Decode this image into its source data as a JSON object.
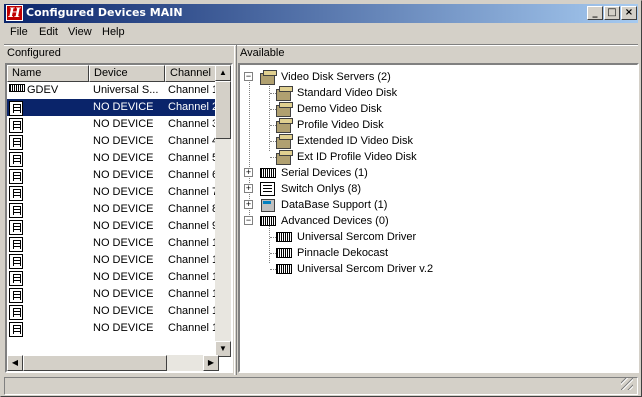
{
  "window": {
    "title": "Configured Devices MAIN",
    "app_icon_letter": "H"
  },
  "menu": {
    "file": "File",
    "edit": "Edit",
    "view": "View",
    "help": "Help"
  },
  "configured": {
    "header": "Configured",
    "columns": [
      "Name",
      "Device",
      "Channel"
    ],
    "rows": [
      {
        "name": "GDEV",
        "device": "Universal S...",
        "channel": "Channel 1"
      },
      {
        "name": "",
        "device": "NO DEVICE",
        "channel": "Channel 2"
      },
      {
        "name": "",
        "device": "NO DEVICE",
        "channel": "Channel 3"
      },
      {
        "name": "",
        "device": "NO DEVICE",
        "channel": "Channel 4"
      },
      {
        "name": "",
        "device": "NO DEVICE",
        "channel": "Channel 5"
      },
      {
        "name": "",
        "device": "NO DEVICE",
        "channel": "Channel 6"
      },
      {
        "name": "",
        "device": "NO DEVICE",
        "channel": "Channel 7"
      },
      {
        "name": "",
        "device": "NO DEVICE",
        "channel": "Channel 8"
      },
      {
        "name": "",
        "device": "NO DEVICE",
        "channel": "Channel 9"
      },
      {
        "name": "",
        "device": "NO DEVICE",
        "channel": "Channel 1"
      },
      {
        "name": "",
        "device": "NO DEVICE",
        "channel": "Channel 1"
      },
      {
        "name": "",
        "device": "NO DEVICE",
        "channel": "Channel 1"
      },
      {
        "name": "",
        "device": "NO DEVICE",
        "channel": "Channel 1"
      },
      {
        "name": "",
        "device": "NO DEVICE",
        "channel": "Channel 1"
      },
      {
        "name": "",
        "device": "NO DEVICE",
        "channel": "Channel 1"
      }
    ],
    "selected_row": 1
  },
  "available": {
    "header": "Available",
    "video_disk_servers": {
      "label": "Video Disk Servers (2)",
      "expander": "−"
    },
    "vds_children": [
      "Standard Video Disk",
      "Demo Video Disk",
      "Profile Video Disk",
      "Extended ID Video Disk",
      "Ext ID Profile Video Disk"
    ],
    "serial_devices": {
      "label": "Serial Devices (1)",
      "expander": "+"
    },
    "switch_onlys": {
      "label": "Switch Onlys (8)",
      "expander": "+"
    },
    "database_support": {
      "label": "DataBase Support (1)",
      "expander": "+"
    },
    "advanced_devices": {
      "label": "Advanced Devices (0)",
      "expander": "−"
    },
    "adv_children": [
      "Universal Sercom Driver",
      "Pinnacle Dekocast",
      "Universal Sercom Driver v.2"
    ]
  },
  "titlebar_buttons": {
    "minimize": "_",
    "maximize": "□",
    "close": "×"
  },
  "scroll_arrows": {
    "up": "▲",
    "down": "▼",
    "left": "◀",
    "right": "▶"
  },
  "icons": {
    "app": "h-logo-icon",
    "device": "tape-device-icon",
    "vds": "video-disk-server-icon",
    "serial": "serial-connector-icon",
    "switch": "switch-icon",
    "db": "database-icon"
  }
}
